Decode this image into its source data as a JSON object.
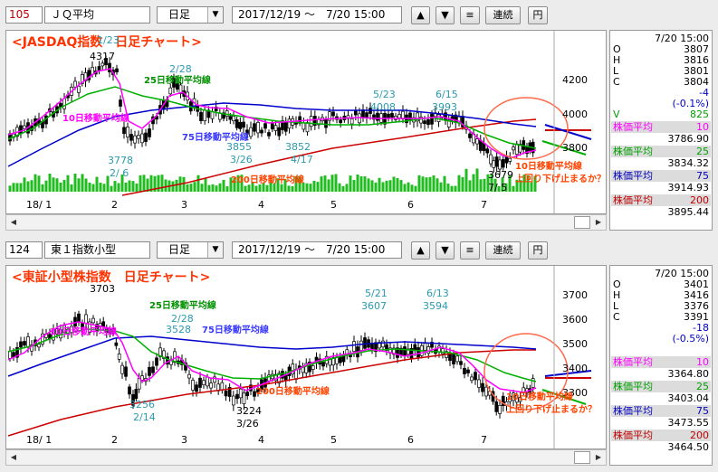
{
  "panels": [
    {
      "code": "105",
      "name": "ＪＱ平均",
      "period": "日足",
      "range": "2017/12/19 ～　7/20 15:00",
      "buttons": {
        "up": "▲",
        "down": "▼",
        "list": "≡",
        "continuous": "連続",
        "yen": "円"
      },
      "chart_title": "<JASDAQ指数　日足チャート>",
      "price_axis": [
        "4200",
        "4000",
        "3800"
      ],
      "month_labels": [
        "18/ 1",
        "2",
        "3",
        "4",
        "5",
        "6",
        "7"
      ],
      "annotations": {
        "peak_date": "1/23",
        "peak_value": "4317",
        "feb28": "2/28",
        "low_a": "3778",
        "low_a_date": "2/ 6",
        "low_b": "3855",
        "low_b_date": "3/26",
        "low_c": "3852",
        "low_c_date": "4/17",
        "may23": "5/23",
        "may23_value": "4008",
        "jun15": "6/15",
        "jun15_value": "3993",
        "low_d": "3679",
        "low_d_date": "7/ 5"
      },
      "ma_labels": {
        "ma25": "25日移動平均線",
        "ma10": "10日移動平均線",
        "ma75": "75日移動平均線",
        "ma200": "200日移動平均線",
        "note1": "10日移動平均線",
        "note2": "上回り下げ止まるか？"
      },
      "info": {
        "datetime": "7/20 15:00",
        "ohlc": [
          {
            "k": "O",
            "v": "3807"
          },
          {
            "k": "H",
            "v": "3816"
          },
          {
            "k": "L",
            "v": "3801"
          },
          {
            "k": "C",
            "v": "3804"
          }
        ],
        "change": "-4",
        "change_pct": "(-0.1%)",
        "volume_label": "V",
        "volume": "825",
        "ma": [
          {
            "label": "株価平均",
            "period": "10",
            "value": "3786.90",
            "color": "#ff00ff"
          },
          {
            "label": "株価平均",
            "period": "25",
            "value": "3834.32",
            "color": "#00a000"
          },
          {
            "label": "株価平均",
            "period": "75",
            "value": "3914.93",
            "color": "#0000c0"
          },
          {
            "label": "株価平均",
            "period": "200",
            "value": "3895.44",
            "color": "#c00000"
          }
        ]
      }
    },
    {
      "code": "124",
      "name": "東１指数小型",
      "period": "日足",
      "range": "2017/12/19 ～　7/20 15:00",
      "buttons": {
        "up": "▲",
        "down": "▼",
        "list": "≡",
        "continuous": "連続",
        "yen": "円"
      },
      "chart_title": "<東証小型株指数　日足チャート>",
      "price_axis": [
        "3700",
        "3600",
        "3500",
        "3400",
        "3300"
      ],
      "month_labels": [
        "18/ 1",
        "2",
        "3",
        "4",
        "5",
        "6",
        "7"
      ],
      "annotations": {
        "peak_value": "3703",
        "feb28": "2/28",
        "feb28_value": "3528",
        "low_a": "3256",
        "low_a_date": "2/14",
        "low_b": "3224",
        "low_b_date": "3/26",
        "may21": "5/21",
        "may21_value": "3607",
        "jun13": "6/13",
        "jun13_value": "3594"
      },
      "ma_labels": {
        "ma25": "25日移動平均線",
        "ma10": "10日移動平均線",
        "ma75": "75日移動平均線",
        "ma200": "200日移動平均線",
        "note1": "10日移動平均線",
        "note2": "上回り下げ止まるか？"
      },
      "info": {
        "datetime": "7/20 15:00",
        "ohlc": [
          {
            "k": "O",
            "v": "3401"
          },
          {
            "k": "H",
            "v": "3416"
          },
          {
            "k": "L",
            "v": "3376"
          },
          {
            "k": "C",
            "v": "3391"
          }
        ],
        "change": "-18",
        "change_pct": "(-0.5%)",
        "ma": [
          {
            "label": "株価平均",
            "period": "10",
            "value": "3364.80",
            "color": "#ff00ff"
          },
          {
            "label": "株価平均",
            "period": "25",
            "value": "3403.04",
            "color": "#00a000"
          },
          {
            "label": "株価平均",
            "period": "75",
            "value": "3473.55",
            "color": "#0000c0"
          },
          {
            "label": "株価平均",
            "period": "200",
            "value": "3464.50",
            "color": "#c00000"
          }
        ]
      }
    }
  ],
  "colors": {
    "ma10": "#ff00ff",
    "ma25": "#00b000",
    "ma75": "#0000cc",
    "ma200": "#cc0000",
    "title": "#ff3300",
    "label_green": "#009000",
    "label_teal": "#2a9ab0",
    "label_blue": "#3a3aff",
    "label_red": "#ff4400",
    "volume": "#22bb22",
    "candle_up": "#ffffff",
    "candle_down": "#000000"
  }
}
